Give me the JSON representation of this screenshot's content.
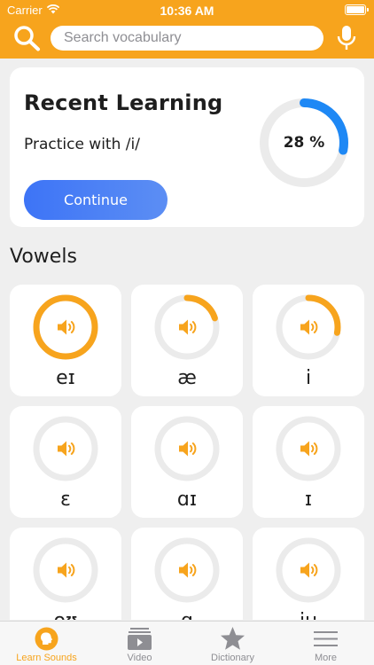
{
  "status_bar": {
    "carrier": "Carrier",
    "time": "10:36 AM"
  },
  "search": {
    "placeholder": "Search vocabulary"
  },
  "recent": {
    "title": "Recent Learning",
    "subtitle": "Practice with /i/",
    "progress_text": "28 %",
    "progress": 0.28,
    "button": "Continue"
  },
  "section": {
    "title": "Vowels"
  },
  "vowels": [
    {
      "symbol": "eɪ",
      "progress": 1.0
    },
    {
      "symbol": "æ",
      "progress": 0.2
    },
    {
      "symbol": "i",
      "progress": 0.28
    },
    {
      "symbol": "ɛ",
      "progress": 0
    },
    {
      "symbol": "ɑɪ",
      "progress": 0
    },
    {
      "symbol": "ɪ",
      "progress": 0
    },
    {
      "symbol": "oʊ",
      "progress": 0
    },
    {
      "symbol": "ɑ",
      "progress": 0
    },
    {
      "symbol": "iu",
      "progress": 0
    }
  ],
  "tabs": [
    {
      "label": "Learn Sounds",
      "icon": "head-icon",
      "active": true
    },
    {
      "label": "Video",
      "icon": "video-icon",
      "active": false
    },
    {
      "label": "Dictionary",
      "icon": "star-icon",
      "active": false
    },
    {
      "label": "More",
      "icon": "menu-icon",
      "active": false
    }
  ],
  "colors": {
    "accent": "#f7a41d",
    "progress_blue": "#1e88f5",
    "button_start": "#3d74f6",
    "button_end": "#5c8ef4"
  }
}
